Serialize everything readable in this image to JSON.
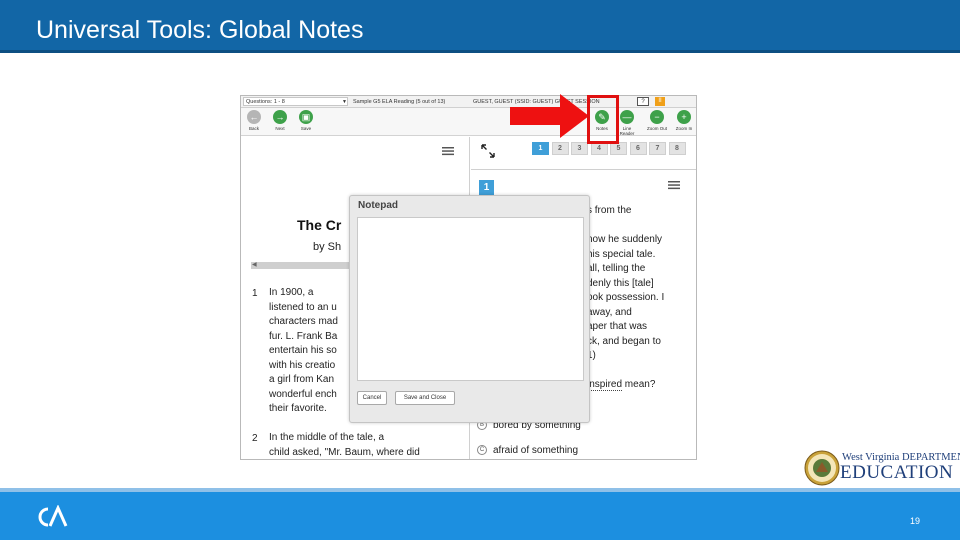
{
  "slide": {
    "title": "Universal Tools: Global Notes",
    "number": "19"
  },
  "logo": {
    "org_top": "West Virginia DEPARTMENT OF",
    "org_bottom": "EDUCATION",
    "footer_logo_icon": "ca-logo-icon"
  },
  "test": {
    "question_select": "Questions: 1 - 8",
    "test_name": "Sample G5 ELA Reading (5 out of 13)",
    "student_info": "GUEST, GUEST (SSID: GUEST)   GUEST SESSION",
    "help_label": "?",
    "pause_label": "II",
    "toolbar": {
      "back": "Back",
      "next": "Next",
      "save": "Save",
      "notes": "Notes",
      "line_reader": "Line Reader",
      "zoom_out": "Zoom Out",
      "zoom_in": "Zoom In"
    },
    "passage": {
      "title": "The Cr",
      "byline": "by Sh",
      "p1_num": "1",
      "p1_lines": [
        "In 1900, a",
        "listened to an u",
        "characters mad",
        "fur. L. Frank Ba",
        "entertain his so",
        "with his creatio",
        "a girl from Kan",
        "wonderful ench",
        "their favorite."
      ],
      "p2_num": "2",
      "p2_lines": [
        "In the middle of the tale, a",
        "child asked, \"Mr. Baum, where did"
      ]
    },
    "tabs": [
      "1",
      "2",
      "3",
      "4",
      "5",
      "6",
      "7",
      "8"
    ],
    "active_tab": "1",
    "question_number": "1",
    "question_lines": [
      "s from the",
      "",
      "now he suddenly",
      "his special tale.",
      "all, telling the",
      "denly this [tale]",
      "ook possession. I",
      "away, and",
      "aper that was",
      "ck, and began to",
      "1)",
      "",
      "inspired mean?"
    ],
    "choices": [
      {
        "letter": "B",
        "text": "bored by something"
      },
      {
        "letter": "C",
        "text": "afraid of something"
      }
    ],
    "notepad": {
      "title": "Notepad",
      "cancel": "Cancel",
      "save_close": "Save and Close"
    }
  },
  "colors": {
    "header_blue": "#1266a6",
    "footer_blue": "#1c8fe0",
    "highlight_red": "#e01010",
    "tab_active": "#3f9fd8"
  }
}
